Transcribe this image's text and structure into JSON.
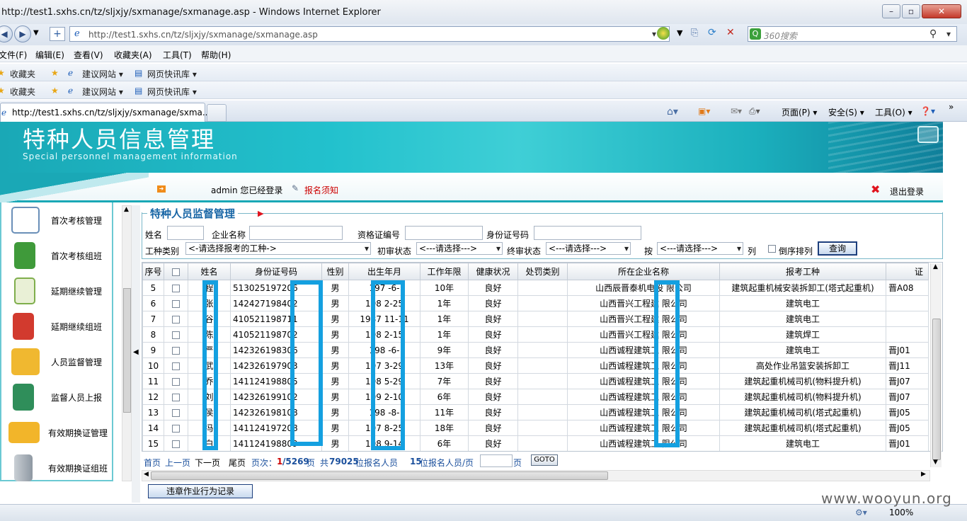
{
  "browser": {
    "window_title": "http://test1.sxhs.cn/tz/sljxjy/sxmanage/sxmanage.asp - Windows Internet Explorer",
    "url": "http://test1.sxhs.cn/tz/sljxjy/sxmanage/sxmanage.asp",
    "search_placeholder": "360搜索",
    "menu": [
      "文件(F)",
      "编辑(E)",
      "查看(V)",
      "收藏夹(A)",
      "工具(T)",
      "帮助(H)"
    ],
    "favorites": {
      "label": "收藏夹",
      "suggest": "建议网站 ▾",
      "slices": "网页快讯库 ▾"
    },
    "tab_title": "http://test1.sxhs.cn/tz/sljxjy/sxmanage/sxma...",
    "commands": {
      "page": "页面(P) ▾",
      "safety": "安全(S) ▾",
      "tools": "工具(O) ▾",
      "help": "❓▾",
      "more": "»"
    },
    "zoom": "100%"
  },
  "banner": {
    "title": "特种人员信息管理",
    "subtitle": "Special personnel management information"
  },
  "topnav": {
    "user_text": "admin 您已经登录",
    "notice": "报名须知",
    "logout": "退出登录"
  },
  "sidebar": {
    "items": [
      {
        "label": "首次考核管理",
        "icon": "chart-icon",
        "color": "#6a8fb8"
      },
      {
        "label": "首次考核组班",
        "icon": "green-notebook-icon",
        "color": "#3f9a3a"
      },
      {
        "label": "延期继续管理",
        "icon": "clipboard-icon",
        "color": "#7fae4c"
      },
      {
        "label": "延期继续组班",
        "icon": "red-notebook-icon",
        "color": "#d23a2e"
      },
      {
        "label": "人员监督管理",
        "icon": "envelope-icon",
        "color": "#f0b830"
      },
      {
        "label": "监督人员上报",
        "icon": "green-book-icon",
        "color": "#2f8e5a"
      },
      {
        "label": "有效期换证管理",
        "icon": "mail-icon",
        "color": "#f2b52a"
      },
      {
        "label": "有效期换证组班",
        "icon": "trash-icon",
        "color": "#9aa4ae"
      }
    ]
  },
  "panel": {
    "title": "特种人员监督管理",
    "labels": {
      "name": "姓名",
      "company": "企业名称",
      "cert_no": "资格证编号",
      "id_no": "身份证号码",
      "work_type": "工种类别",
      "initial_status": "初审状态",
      "final_status": "终审状态",
      "by": "按",
      "column": "列",
      "reverse": "倒序排列"
    },
    "work_type_select": "<-请选择报考的工种->",
    "initial_select": "<---请选择--->",
    "final_select": "<---请选择--->",
    "sort_select": "<---请选择--->",
    "query_button": "查询"
  },
  "table": {
    "headers": [
      "序号",
      "",
      "姓名",
      "身份证号码",
      "性别",
      "出生年月",
      "工作年限",
      "健康状况",
      "处罚类别",
      "所在企业名称",
      "报考工种",
      "证"
    ],
    "rows": [
      {
        "no": "5",
        "name": "程",
        "id": "513025197206",
        "sex": "男",
        "birth": "197 -6-",
        "years": "10年",
        "health": "良好",
        "penalty": "",
        "company": "山西辰晋泰机电设 限公司",
        "job": "建筑起重机械安装拆卸工(塔式起重机)",
        "cert": "晋A08"
      },
      {
        "no": "6",
        "name": "张",
        "id": "142427198402",
        "sex": "男",
        "birth": "198 2-25",
        "years": "1年",
        "health": "良好",
        "penalty": "",
        "company": "山西晋兴工程建 限公司",
        "job": "建筑电工",
        "cert": ""
      },
      {
        "no": "7",
        "name": "谷",
        "id": "410521198711",
        "sex": "男",
        "birth": "1987 11-11",
        "years": "1年",
        "health": "良好",
        "penalty": "",
        "company": "山西晋兴工程建 限公司",
        "job": "建筑电工",
        "cert": ""
      },
      {
        "no": "8",
        "name": "陈",
        "id": "410521198702",
        "sex": "男",
        "birth": "198 2-15",
        "years": "1年",
        "health": "良好",
        "penalty": "",
        "company": "山西晋兴工程建 限公司",
        "job": "建筑焊工",
        "cert": ""
      },
      {
        "no": "9",
        "name": "严",
        "id": "142326198306",
        "sex": "男",
        "birth": "198 -6-",
        "years": "9年",
        "health": "良好",
        "penalty": "",
        "company": "山西诚程建筑工 限公司",
        "job": "建筑电工",
        "cert": "晋J01"
      },
      {
        "no": "10",
        "name": "武",
        "id": "142326197903",
        "sex": "男",
        "birth": "197 3-29",
        "years": "13年",
        "health": "良好",
        "penalty": "",
        "company": "山西诚程建筑工 限公司",
        "job": "高处作业吊篮安装拆卸工",
        "cert": "晋J11"
      },
      {
        "no": "11",
        "name": "乔",
        "id": "141124198805",
        "sex": "男",
        "birth": "198 5-29",
        "years": "7年",
        "health": "良好",
        "penalty": "",
        "company": "山西诚程建筑工 限公司",
        "job": "建筑起重机械司机(物料提升机)",
        "cert": "晋J07"
      },
      {
        "no": "12",
        "name": "刘",
        "id": "142326199102",
        "sex": "男",
        "birth": "199 2-10",
        "years": "6年",
        "health": "良好",
        "penalty": "",
        "company": "山西诚程建筑工 限公司",
        "job": "建筑起重机械司机(物料提升机)",
        "cert": "晋J07"
      },
      {
        "no": "13",
        "name": "侯",
        "id": "142326198108",
        "sex": "男",
        "birth": "198 -8-",
        "years": "11年",
        "health": "良好",
        "penalty": "",
        "company": "山西诚程建筑工 限公司",
        "job": "建筑起重机械司机(塔式起重机)",
        "cert": "晋J05"
      },
      {
        "no": "14",
        "name": "冯",
        "id": "141124197208",
        "sex": "男",
        "birth": "197 8-25",
        "years": "18年",
        "health": "良好",
        "penalty": "",
        "company": "山西诚程建筑工 限公司",
        "job": "建筑起重机械司机(塔式起重机)",
        "cert": "晋J05"
      },
      {
        "no": "15",
        "name": "白",
        "id": "141124198809",
        "sex": "男",
        "birth": "198 9-14",
        "years": "6年",
        "health": "良好",
        "penalty": "",
        "company": "山西诚程建筑工 限公司",
        "job": "建筑电工",
        "cert": "晋J01"
      }
    ]
  },
  "pager": {
    "first": "首页",
    "prev": "上一页",
    "next": "下一页",
    "last": "尾页",
    "page_label": "页次：",
    "current": "1",
    "total": "/5269",
    "page_suffix": "页",
    "total_prefix": "共",
    "total_count": "79025",
    "total_suffix": "位报名人员",
    "per_page_count": "15",
    "per_page_suffix": "位报名人员/页",
    "goto_suffix": "页",
    "goto_button": "GOTO"
  },
  "violation_button": "违章作业行为记录",
  "watermark": "www.wooyun.org"
}
